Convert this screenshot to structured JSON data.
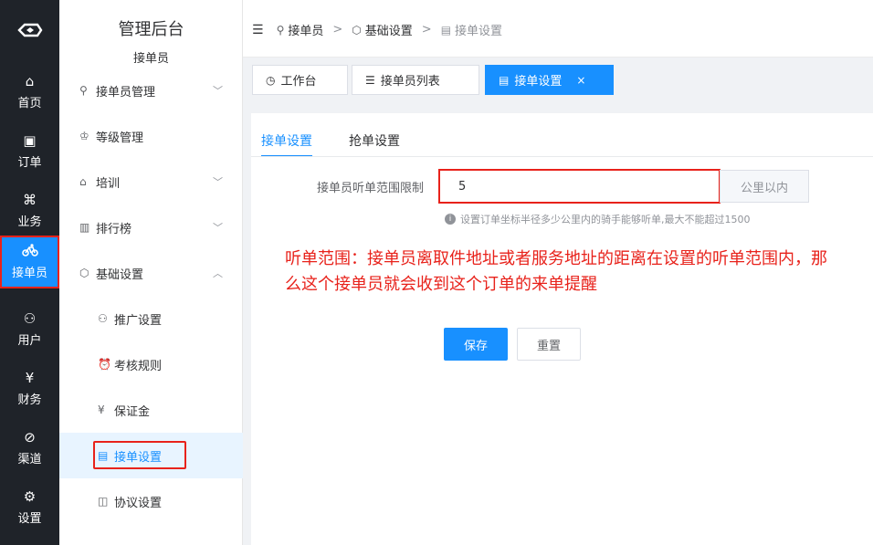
{
  "rail": {
    "items": [
      {
        "icon": "home-icon",
        "glyph": "⌂",
        "label": "首页"
      },
      {
        "icon": "order-icon",
        "glyph": "▣",
        "label": "订单"
      },
      {
        "icon": "business-icon",
        "glyph": "⌘",
        "label": "业务"
      },
      {
        "icon": "rider-icon",
        "glyph": "🚲",
        "label": "接单员"
      },
      {
        "icon": "user-icon",
        "glyph": "⚇",
        "label": "用户"
      },
      {
        "icon": "finance-icon",
        "glyph": "¥",
        "label": "财务"
      },
      {
        "icon": "channel-icon",
        "glyph": "⊘",
        "label": "渠道"
      },
      {
        "icon": "settings-icon",
        "glyph": "⚙",
        "label": "设置"
      }
    ]
  },
  "sidebar": {
    "title": "管理后台",
    "subtitle": "接单员",
    "items": [
      {
        "label": "接单员管理",
        "icon": "bike-icon",
        "glyph": "⚲",
        "chevron": "﹀"
      },
      {
        "label": "等级管理",
        "icon": "level-icon",
        "glyph": "♔",
        "chevron": ""
      },
      {
        "label": "培训",
        "icon": "training-icon",
        "glyph": "⌂",
        "chevron": "﹀"
      },
      {
        "label": "排行榜",
        "icon": "ranking-icon",
        "glyph": "▥",
        "chevron": "﹀"
      },
      {
        "label": "基础设置",
        "icon": "settings-icon",
        "glyph": "⬡",
        "chevron": "︿"
      },
      {
        "label": "推广设置",
        "icon": "promote-icon",
        "glyph": "⚇",
        "chevron": ""
      },
      {
        "label": "考核规则",
        "icon": "assess-icon",
        "glyph": "⏰",
        "chevron": ""
      },
      {
        "label": "保证金",
        "icon": "deposit-icon",
        "glyph": "¥",
        "chevron": ""
      },
      {
        "label": "接单设置",
        "icon": "order-settings-icon",
        "glyph": "▤",
        "chevron": ""
      },
      {
        "label": "协议设置",
        "icon": "agreement-icon",
        "glyph": "◫",
        "chevron": ""
      }
    ]
  },
  "breadcrumb": {
    "items": [
      "接单员",
      "基础设置",
      "接单设置"
    ]
  },
  "tabs": {
    "workbench": "工作台",
    "rider_list": "接单员列表",
    "order_settings": "接单设置",
    "close": "×"
  },
  "panel": {
    "tabs": [
      "接单设置",
      "抢单设置"
    ],
    "field_label": "接单员听单范围限制",
    "field_value": "5",
    "field_append": "公里以内",
    "hint": "设置订单坐标半径多少公里内的骑手能够听单,最大不能超过1500",
    "note": "听单范围：接单员离取件地址或者服务地址的距离在设置的听单范围内，那么这个接单员就会收到这个订单的来单提醒",
    "save": "保存",
    "reset": "重置"
  },
  "colors": {
    "accent": "#1890ff",
    "annotation": "#e8221b",
    "rail_bg": "#1f2329"
  }
}
